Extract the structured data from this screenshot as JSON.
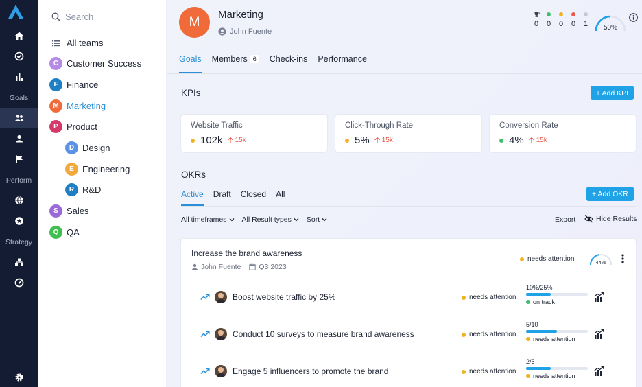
{
  "rail": {
    "labels": [
      "Goals",
      "Perform",
      "Strategy"
    ]
  },
  "search": {
    "placeholder": "Search"
  },
  "teams": [
    {
      "name": "All teams",
      "icon": "list-icon"
    },
    {
      "name": "Customer Success",
      "initial": "C",
      "color": "#b48ae6"
    },
    {
      "name": "Finance",
      "initial": "F",
      "color": "#1f7fc4"
    },
    {
      "name": "Marketing",
      "initial": "M",
      "color": "#f06a3a",
      "selected": true
    },
    {
      "name": "Product",
      "initial": "P",
      "color": "#d6386a"
    },
    {
      "name": "Design",
      "initial": "D",
      "color": "#5a92e6",
      "child": true
    },
    {
      "name": "Engineering",
      "initial": "E",
      "color": "#f2a93b",
      "child": true
    },
    {
      "name": "R&D",
      "initial": "R",
      "color": "#1f7fc4",
      "child": true
    },
    {
      "name": "Sales",
      "initial": "S",
      "color": "#9c6ad8"
    },
    {
      "name": "QA",
      "initial": "Q",
      "color": "#3fbf4f"
    }
  ],
  "header": {
    "avatar_initial": "M",
    "title": "Marketing",
    "owner": "John Fuente",
    "scores": [
      {
        "color": "#3a3f4f",
        "value": "0",
        "icon": "trophy-icon"
      },
      {
        "color": "#3fbf6a",
        "value": "0"
      },
      {
        "color": "#f2b21d",
        "value": "0"
      },
      {
        "color": "#e9574a",
        "value": "0"
      },
      {
        "color": "#c5c9d3",
        "value": "1"
      }
    ],
    "progress_label": "50%",
    "progress": 0.5
  },
  "tabs": {
    "goals": "Goals",
    "members": "Members",
    "members_count": "6",
    "checkins": "Check-ins",
    "performance": "Performance"
  },
  "kpis": {
    "title": "KPIs",
    "add_label": "+ Add KPI",
    "items": [
      {
        "name": "Website Traffic",
        "value": "102k",
        "trend": "15k",
        "dot": "#f2b21d"
      },
      {
        "name": "Click-Through Rate",
        "value": "5%",
        "trend": "15k",
        "dot": "#f2b21d"
      },
      {
        "name": "Conversion Rate",
        "value": "4%",
        "trend": "15k",
        "dot": "#3fbf6a"
      }
    ]
  },
  "okrs": {
    "title": "OKRs",
    "add_label": "+ Add OKR",
    "tabs": [
      "Active",
      "Draft",
      "Closed",
      "All"
    ],
    "filters": [
      "All timeframes",
      "All Result types",
      "Sort"
    ],
    "export_label": "Export",
    "hide_label": "Hide Results",
    "objective": {
      "title": "Increase the brand awareness",
      "owner": "John Fuente",
      "period": "Q3 2023",
      "status": "needs attention",
      "progress_label": "44%",
      "progress": 0.44,
      "key_results": [
        {
          "title": "Boost website traffic by 25%",
          "status": "needs attention",
          "progress_label": "10%/25%",
          "progress": 0.4,
          "sub_status": "on track",
          "sub_color": "#3fbf6a"
        },
        {
          "title": "Conduct 10 surveys to measure brand awareness",
          "status": "needs attention",
          "progress_label": "5/10",
          "progress": 0.5,
          "sub_status": "needs attention",
          "sub_color": "#f2b21d"
        },
        {
          "title": "Engage 5 influencers to promote the brand",
          "status": "needs attention",
          "progress_label": "2/5",
          "progress": 0.4,
          "sub_status": "needs attention",
          "sub_color": "#f2b21d"
        }
      ]
    }
  }
}
